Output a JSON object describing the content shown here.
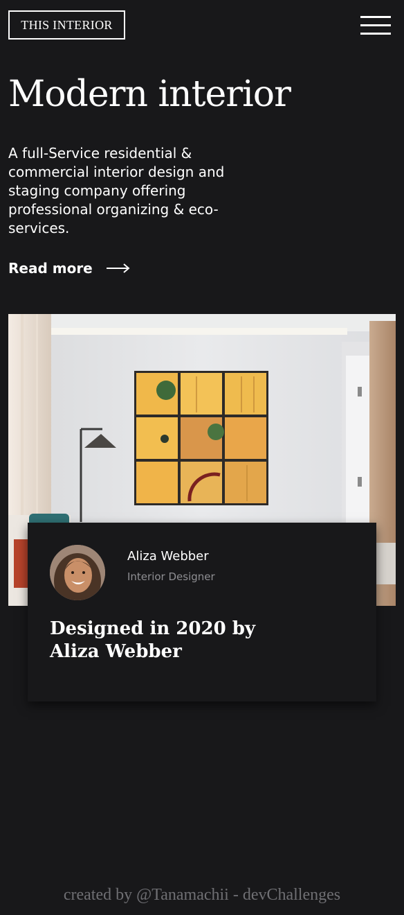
{
  "header": {
    "logo_text": "THIS INTERIOR",
    "menu_icon": "hamburger-menu-icon"
  },
  "hero": {
    "title": "Modern interior",
    "description": "A full-Service residential & commercial interior design and staging company offering professional organizing & eco-services.",
    "read_more_label": "Read more",
    "read_more_icon": "arrow-right-icon"
  },
  "card": {
    "author_name": "Aliza Webber",
    "author_role": "Interior Designer",
    "title": "Designed in 2020 by Aliza Webber"
  },
  "footer": {
    "credit": "created by @Tanamachii - devChallenges"
  },
  "colors": {
    "background": "#18181a",
    "text": "#ffffff",
    "muted": "#8f8f93",
    "credit": "#6f6f73"
  }
}
